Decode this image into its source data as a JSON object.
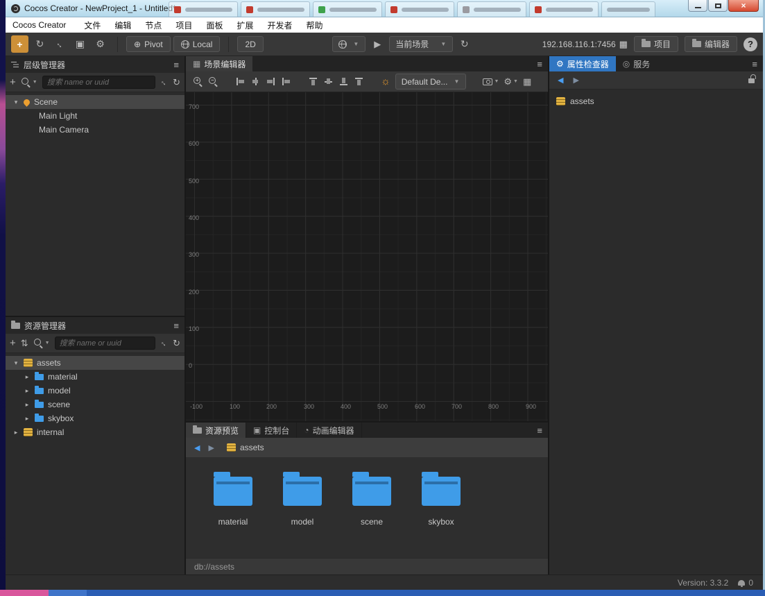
{
  "window": {
    "title": "Cocos Creator - NewProject_1 - Untitled*"
  },
  "menu_bar": {
    "app_name": "Cocos Creator",
    "items": [
      "文件",
      "编辑",
      "节点",
      "项目",
      "面板",
      "扩展",
      "开发者",
      "帮助"
    ]
  },
  "toolbar": {
    "pivot_label": "Pivot",
    "local_label": "Local",
    "mode_2d": "2D",
    "scene_dropdown": "当前场景",
    "preview_address": "192.168.116.1:7456",
    "project_button": "项目",
    "editor_button": "编辑器",
    "help_label": "?"
  },
  "hierarchy": {
    "title": "层级管理器",
    "search_placeholder": "搜索 name or uuid",
    "rows": [
      "Scene",
      "Main Light",
      "Main Camera"
    ]
  },
  "assets_panel": {
    "title": "资源管理器",
    "search_placeholder": "搜索 name or uuid",
    "rows": [
      "assets",
      "material",
      "model",
      "scene",
      "skybox",
      "internal"
    ]
  },
  "scene": {
    "tab": "场景编辑器",
    "gizmo_dropdown": "Default De...",
    "v_ruler": [
      "700",
      "600",
      "500",
      "400",
      "300",
      "200",
      "100",
      "0"
    ],
    "h_ruler": [
      "-100",
      "100",
      "200",
      "300",
      "400",
      "500",
      "600",
      "700",
      "800",
      "900"
    ]
  },
  "preview_panel": {
    "tabs": [
      "资源预览",
      "控制台",
      "动画编辑器"
    ],
    "breadcrumb": "assets",
    "folders": [
      "material",
      "model",
      "scene",
      "skybox"
    ],
    "path": "db://assets"
  },
  "inspector": {
    "tabs": [
      "属性检查器",
      "服务"
    ],
    "item": "assets"
  },
  "status_bar": {
    "version": "Version: 3.3.2",
    "notifications": "0"
  },
  "colors": {
    "accent_orange": "#cd9038",
    "accent_blue": "#3076c2",
    "folder_blue": "#3f9ce8",
    "db_gold": "#e3b341",
    "titlebar_blue": "#bfe0f0"
  }
}
